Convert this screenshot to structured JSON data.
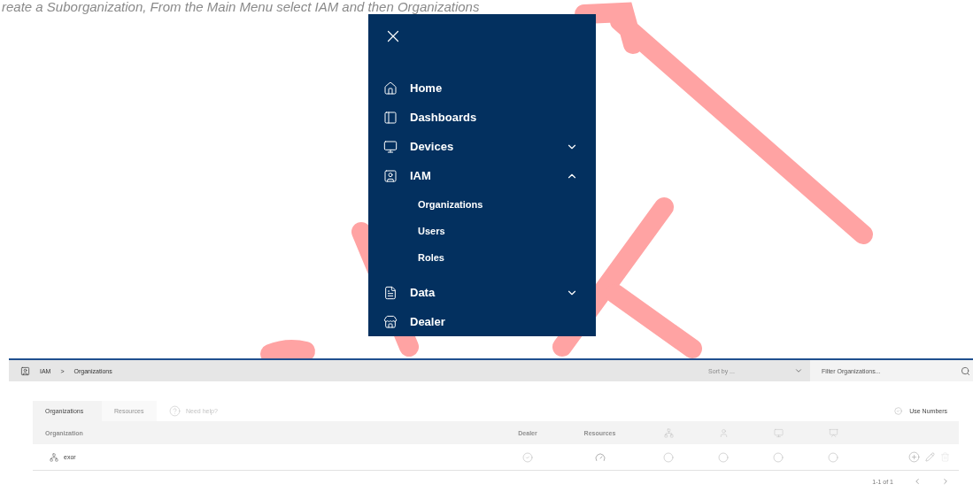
{
  "caption": "reate a Suborganization, From the Main Menu select IAM and then Organizations",
  "menu": {
    "items": [
      {
        "label": "Home",
        "kind": "link"
      },
      {
        "label": "Dashboards",
        "kind": "link"
      },
      {
        "label": "Devices",
        "kind": "group",
        "expanded": false
      },
      {
        "label": "IAM",
        "kind": "group",
        "expanded": true,
        "children": [
          {
            "label": "Organizations"
          },
          {
            "label": "Users"
          },
          {
            "label": "Roles"
          }
        ]
      },
      {
        "label": "Data",
        "kind": "group",
        "expanded": false
      },
      {
        "label": "Dealer",
        "kind": "link"
      }
    ]
  },
  "breadcrumb": {
    "items": [
      "IAM",
      "Organizations"
    ],
    "separator": ">"
  },
  "sort": {
    "placeholder": "Sort by ..."
  },
  "filter": {
    "placeholder": "Filter Organizations..."
  },
  "tabs": [
    {
      "label": "Organizations",
      "selected": true
    },
    {
      "label": "Resources",
      "selected": false
    }
  ],
  "help": "Need help?",
  "use_numbers": {
    "label": "Use Numbers",
    "checked": false
  },
  "table": {
    "columns": [
      "Organization",
      "Dealer",
      "Resources"
    ],
    "rows": [
      {
        "name": "exor",
        "dealer": true,
        "flags": [
          false,
          false,
          false,
          false
        ]
      }
    ]
  },
  "pagination": "1-1 of 1"
}
